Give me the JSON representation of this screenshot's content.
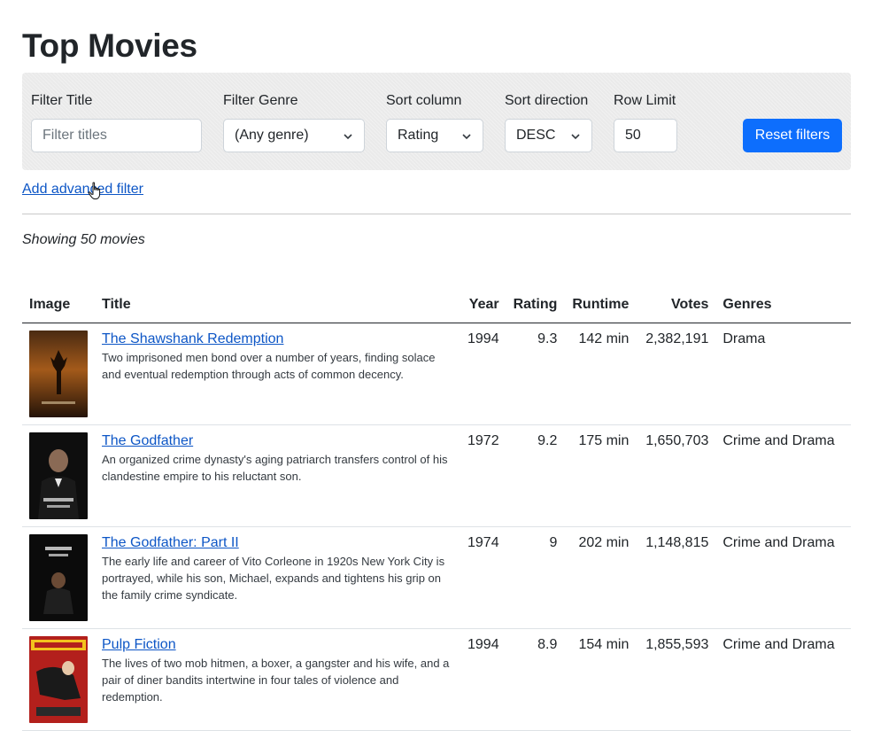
{
  "page": {
    "title": "Top Movies"
  },
  "filters": {
    "title_label": "Filter Title",
    "title_placeholder": "Filter titles",
    "genre_label": "Filter Genre",
    "genre_value": "(Any genre)",
    "sort_column_label": "Sort column",
    "sort_column_value": "Rating",
    "sort_direction_label": "Sort direction",
    "sort_direction_value": "DESC",
    "row_limit_label": "Row Limit",
    "row_limit_value": "50",
    "reset_label": "Reset filters"
  },
  "advanced_link": "Add advanced filter",
  "showing": "Showing 50 movies",
  "table": {
    "headers": {
      "image": "Image",
      "title": "Title",
      "year": "Year",
      "rating": "Rating",
      "runtime": "Runtime",
      "votes": "Votes",
      "genres": "Genres"
    },
    "rows": [
      {
        "title": "The Shawshank Redemption",
        "description": "Two imprisoned men bond over a number of years, finding solace and eventual redemption through acts of common decency.",
        "year": "1994",
        "rating": "9.3",
        "runtime": "142 min",
        "votes": "2,382,191",
        "genres": "Drama"
      },
      {
        "title": "The Godfather",
        "description": "An organized crime dynasty's aging patriarch transfers control of his clandestine empire to his reluctant son.",
        "year": "1972",
        "rating": "9.2",
        "runtime": "175 min",
        "votes": "1,650,703",
        "genres": "Crime and Drama"
      },
      {
        "title": "The Godfather: Part II",
        "description": "The early life and career of Vito Corleone in 1920s New York City is portrayed, while his son, Michael, expands and tightens his grip on the family crime syndicate.",
        "year": "1974",
        "rating": "9",
        "runtime": "202 min",
        "votes": "1,148,815",
        "genres": "Crime and Drama"
      },
      {
        "title": "Pulp Fiction",
        "description": "The lives of two mob hitmen, a boxer, a gangster and his wife, and a pair of diner bandits intertwine in four tales of violence and redemption.",
        "year": "1994",
        "rating": "8.9",
        "runtime": "154 min",
        "votes": "1,855,593",
        "genres": "Crime and Drama"
      }
    ]
  },
  "colors": {
    "accent": "#0d6efd",
    "link": "#0d56c6",
    "filter_bg": "#eaeaea"
  },
  "icons": {
    "select_chevron": "chevron-down-icon",
    "cursor": "hand-pointer-icon"
  }
}
